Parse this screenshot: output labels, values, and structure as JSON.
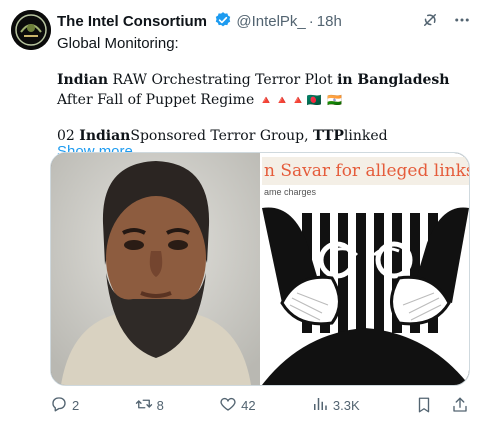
{
  "account": {
    "name": "The Intel Consortium",
    "handle": "@IntelPk_",
    "separator": "·",
    "time": "18h"
  },
  "post": {
    "line1": "Global Monitoring:",
    "headline_parts": [
      {
        "text": "Indian",
        "bold": true
      },
      {
        "text": " RAW Orchestrating Terror Plot ",
        "bold": false
      },
      {
        "text": "in Bangladesh",
        "bold": true
      },
      {
        "text": " After Fall of Puppet Regime",
        "bold": false
      }
    ],
    "headline_flags": "🔺🔺🔺🇧🇩 🇮🇳",
    "line3_parts": [
      {
        "text": "02 ",
        "bold": false
      },
      {
        "text": "Indian",
        "bold": true
      },
      {
        "text": "Sponsored Terror Group, ",
        "bold": false
      },
      {
        "text": "TTP",
        "bold": true
      },
      {
        "text": "linked",
        "bold": false
      }
    ],
    "show_more": "Show more"
  },
  "media": {
    "right_title": "n Savar for alleged links to Tehri",
    "right_subtitle": "ame charges"
  },
  "actions": {
    "replies": "2",
    "reposts": "8",
    "likes": "42",
    "views": "3.3K"
  },
  "icons": {
    "verified": "verified-badge-icon",
    "grok": "grok-icon",
    "more": "more-icon",
    "reply": "reply-icon",
    "repost": "repost-icon",
    "like": "heart-icon",
    "views": "views-icon",
    "bookmark": "bookmark-icon",
    "share": "share-icon"
  },
  "colors": {
    "verified": "#1d9bf0",
    "link": "#1d9bf0",
    "secondary_text": "#536471",
    "news_title": "#e55c3b"
  }
}
